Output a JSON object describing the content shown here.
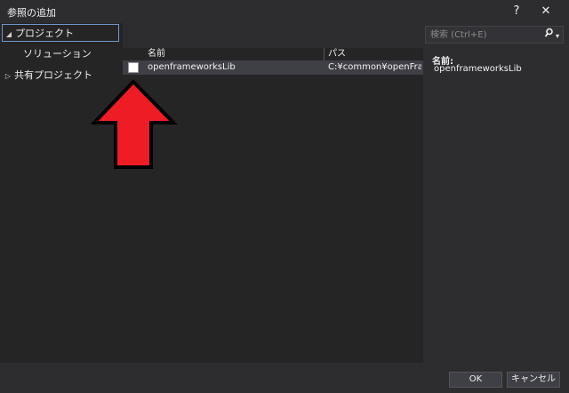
{
  "window": {
    "title": "参照の追加",
    "help_label": "?",
    "close_label": "✕"
  },
  "tree": {
    "items": [
      {
        "label": "プロジェクト",
        "expander": "◢",
        "selected": true
      },
      {
        "label": "ソリューション",
        "expander": ""
      },
      {
        "label": "共有プロジェクト",
        "expander": "▷"
      }
    ]
  },
  "search": {
    "placeholder": "検索 (Ctrl+E)",
    "icon": "search-icon",
    "dropdown_glyph": "▾"
  },
  "table": {
    "columns": [
      "名前",
      "パス"
    ],
    "rows": [
      {
        "checked": false,
        "name": "openframeworksLib",
        "path": "C:¥common¥openFra..."
      }
    ]
  },
  "details": {
    "label": "名前:",
    "value": "openframeworksLib"
  },
  "buttons": {
    "ok": "OK",
    "cancel": "キャンセル"
  },
  "annotation": {
    "type": "red-arrow-pointing-up",
    "fill_color": "#ee1c24",
    "stroke_color": "#000000"
  },
  "colors": {
    "background": "#2d2d30",
    "panel": "#252526",
    "selected_row": "#3f3f46",
    "selection_border": "#6e97c7"
  }
}
